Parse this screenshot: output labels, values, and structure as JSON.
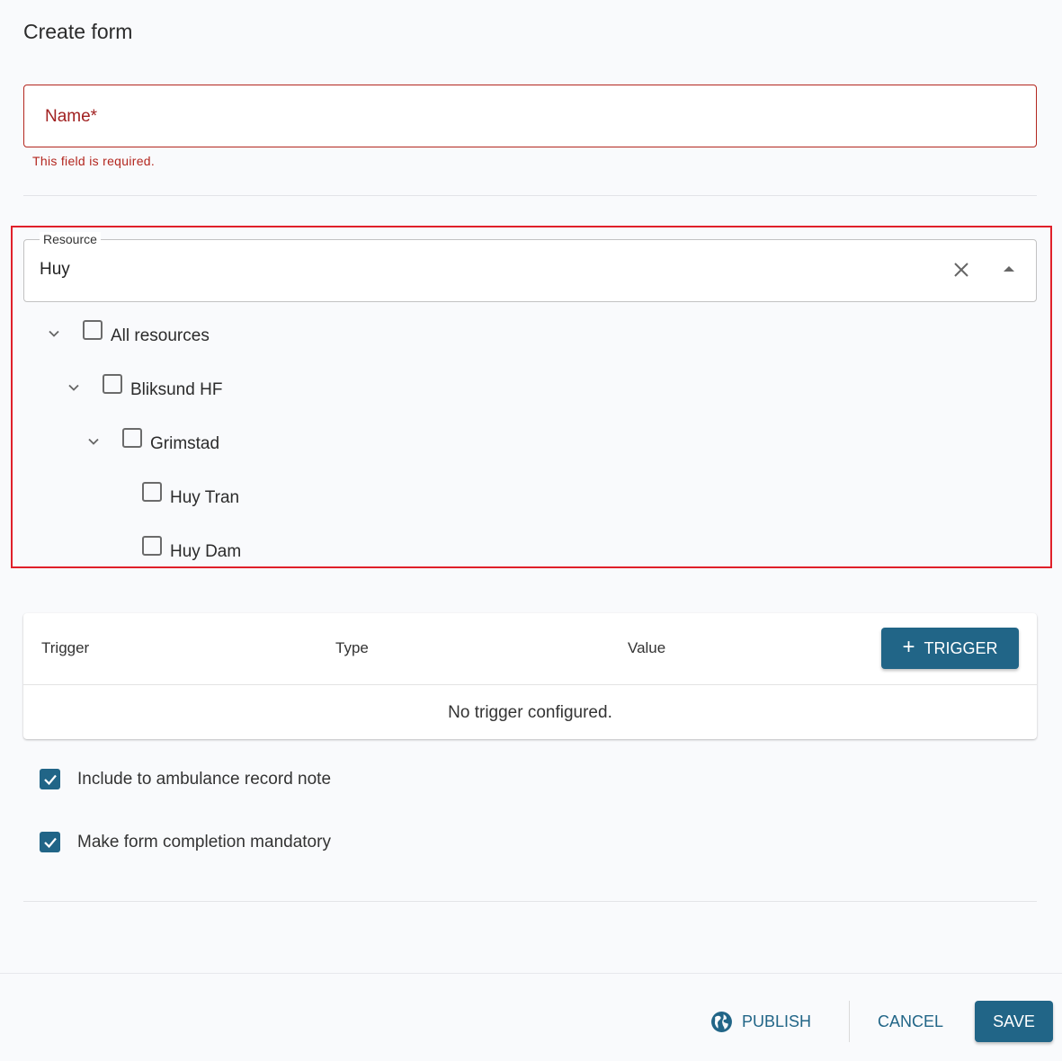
{
  "page": {
    "title": "Create form"
  },
  "name_field": {
    "label": "Name*",
    "value": "",
    "error": "This field is required."
  },
  "resource_field": {
    "legend": "Resource",
    "value": "Huy",
    "clear_icon": "close-icon",
    "toggle_icon": "arrow-up-icon"
  },
  "tree": {
    "items": [
      {
        "label": "All resources",
        "expanded": true,
        "checked": false,
        "level": 0
      },
      {
        "label": "Bliksund HF",
        "expanded": true,
        "checked": false,
        "level": 1
      },
      {
        "label": "Grimstad",
        "expanded": true,
        "checked": false,
        "level": 2
      },
      {
        "label": "Huy Tran",
        "checked": false,
        "level": 3
      },
      {
        "label": "Huy Dam",
        "checked": false,
        "level": 3
      }
    ]
  },
  "triggers": {
    "columns": [
      "Trigger",
      "Type",
      "Value"
    ],
    "add_button": "TRIGGER",
    "empty_text": "No trigger configured."
  },
  "options": [
    {
      "label": "Include to ambulance record note",
      "checked": true
    },
    {
      "label": "Make form completion mandatory",
      "checked": true
    }
  ],
  "footer": {
    "publish": "PUBLISH",
    "cancel": "CANCEL",
    "save": "SAVE"
  },
  "colors": {
    "primary": "#216587",
    "error": "#b3261e",
    "highlight": "#e0202a"
  }
}
